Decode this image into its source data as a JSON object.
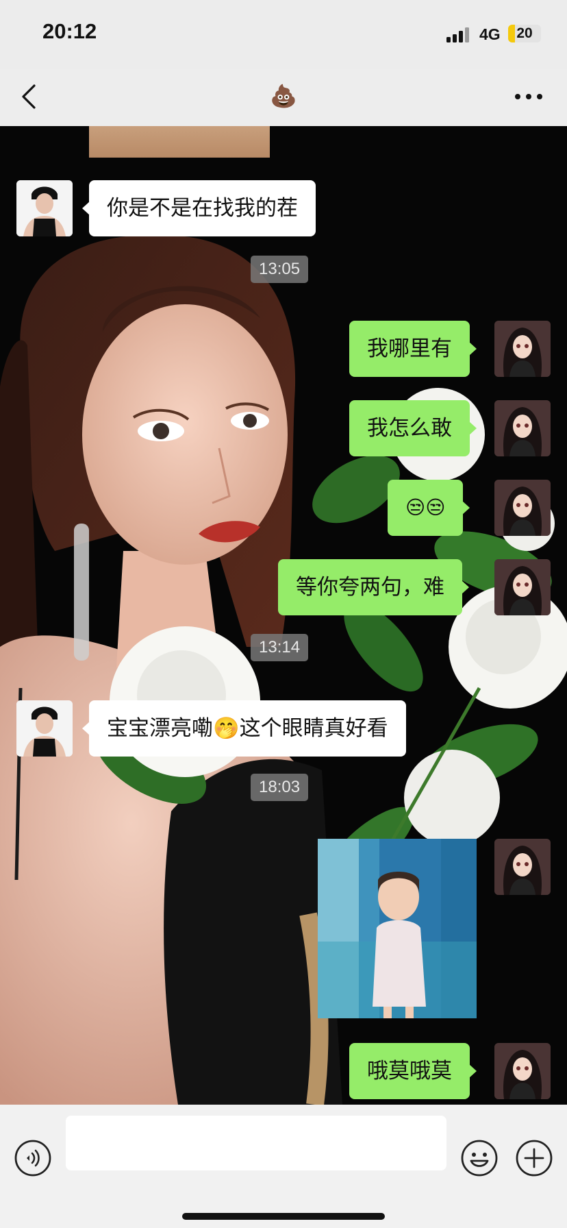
{
  "status_bar": {
    "time": "20:12",
    "network": "4G",
    "battery": "20",
    "battery_level_percent": 20
  },
  "nav": {
    "title": "💩",
    "back_icon": "chevron-left-icon",
    "more_icon": "more-dots-icon"
  },
  "chat": {
    "messages": [
      {
        "side": "left",
        "type": "text",
        "text": "你是不是在找我的茬"
      },
      {
        "type": "time",
        "text": "13:05"
      },
      {
        "side": "right",
        "type": "text",
        "text": "我哪里有"
      },
      {
        "side": "right",
        "type": "text",
        "text": "我怎么敢"
      },
      {
        "side": "right",
        "type": "text",
        "text": "😒😒"
      },
      {
        "side": "right",
        "type": "text",
        "text": "等你夸两句，难"
      },
      {
        "type": "time",
        "text": "13:14"
      },
      {
        "side": "left",
        "type": "text",
        "text": "宝宝漂亮嘞🤭这个眼睛真好看"
      },
      {
        "type": "time",
        "text": "18:03"
      },
      {
        "side": "right",
        "type": "image",
        "text": ""
      },
      {
        "side": "right",
        "type": "text",
        "text": "哦莫哦莫"
      }
    ]
  },
  "input_bar": {
    "value": "",
    "placeholder": "",
    "voice_icon": "voice-icon",
    "emoji_icon": "emoji-icon",
    "plus_icon": "plus-icon"
  },
  "colors": {
    "bubble_right": "#95ec69",
    "bubble_left": "#ffffff",
    "nav_bg": "#ededed"
  }
}
